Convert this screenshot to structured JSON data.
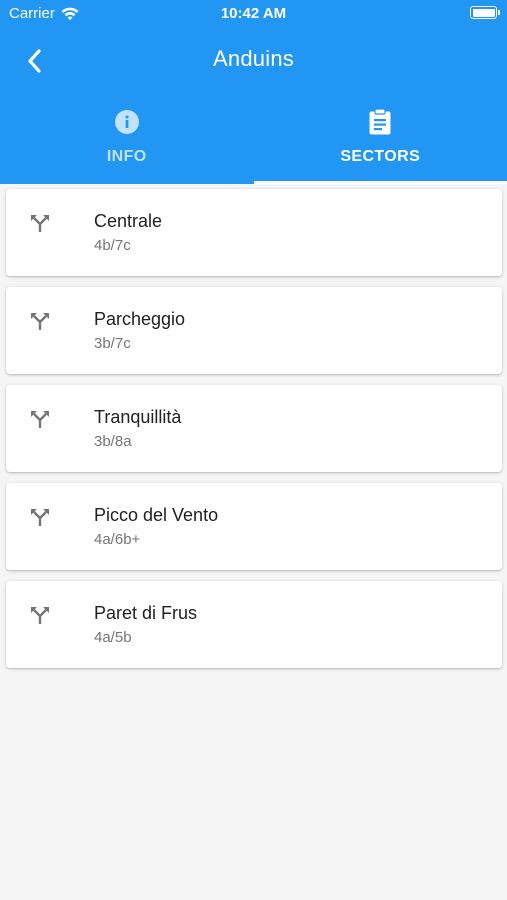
{
  "status_bar": {
    "carrier": "Carrier",
    "time": "10:42 AM"
  },
  "app_bar": {
    "title": "Anduins",
    "back_icon": "chevron-left-icon"
  },
  "tabs": [
    {
      "label": "INFO",
      "icon": "info-icon",
      "active": false
    },
    {
      "label": "SECTORS",
      "icon": "clipboard-icon",
      "active": true
    }
  ],
  "sectors": [
    {
      "name": "Centrale",
      "grade": "4b/7c"
    },
    {
      "name": "Parcheggio",
      "grade": "3b/7c"
    },
    {
      "name": "Tranquillità",
      "grade": "3b/8a"
    },
    {
      "name": "Picco del Vento",
      "grade": "4a/6b+"
    },
    {
      "name": "Paret di Frus",
      "grade": "4a/5b"
    }
  ],
  "colors": {
    "primary": "#2196f3",
    "background": "#f5f5f5",
    "icon_gray": "#757575"
  }
}
